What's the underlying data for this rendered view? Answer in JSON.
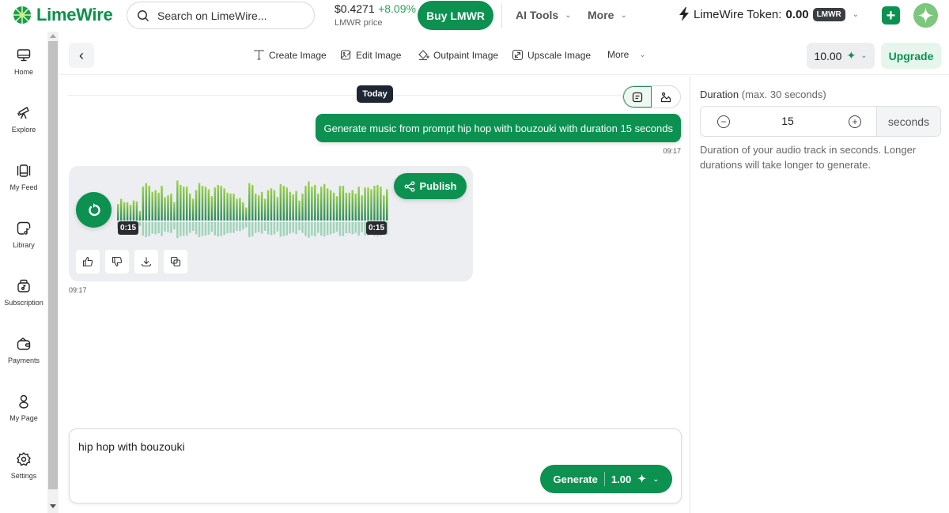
{
  "header": {
    "brand": "LimeWire",
    "search_placeholder": "Search on LimeWire...",
    "price_value": "$0.4271",
    "price_change": "+8.09%",
    "price_label": "LMWR price",
    "buy_label": "Buy LMWR",
    "menus": [
      {
        "label": "AI Tools"
      },
      {
        "label": "More"
      }
    ],
    "token_label": "LimeWire Token:",
    "token_value": "0.00",
    "token_badge": "LMWR"
  },
  "sidebar": {
    "items": [
      {
        "label": "Home",
        "icon": "monitor-icon"
      },
      {
        "label": "Explore",
        "icon": "telescope-icon"
      },
      {
        "label": "My Feed",
        "icon": "feed-icon"
      },
      {
        "label": "Library",
        "icon": "library-icon"
      },
      {
        "label": "Subscription",
        "icon": "subscription-icon"
      },
      {
        "label": "Payments",
        "icon": "wallet-icon"
      },
      {
        "label": "My Page",
        "icon": "user-icon"
      },
      {
        "label": "Settings",
        "icon": "gear-icon"
      }
    ]
  },
  "toolbar": {
    "tools": [
      {
        "label": "Create Image",
        "icon": "text-icon"
      },
      {
        "label": "Edit Image",
        "icon": "edit-image-icon"
      },
      {
        "label": "Outpaint Image",
        "icon": "outpaint-icon"
      },
      {
        "label": "Upscale Image",
        "icon": "upscale-icon"
      },
      {
        "label": "More",
        "icon": "chevron-down-icon"
      }
    ],
    "credits": "10.00",
    "upgrade_label": "Upgrade"
  },
  "chat": {
    "date_divider": "Today",
    "user_message": "Generate music from prompt hip hop with bouzouki with duration 15 seconds",
    "user_message_time": "09:17",
    "audio": {
      "start_time": "0:15",
      "end_time": "0:15",
      "publish_label": "Publish",
      "waveform": [
        0.38,
        0.5,
        0.42,
        0.42,
        0.36,
        0.46,
        0.44,
        0.22,
        0.78,
        0.86,
        0.8,
        0.66,
        0.7,
        0.64,
        0.8,
        0.54,
        0.58,
        0.62,
        0.42,
        0.92,
        0.82,
        0.78,
        0.78,
        0.62,
        0.5,
        0.7,
        0.86,
        0.8,
        0.78,
        0.72,
        0.56,
        0.76,
        0.82,
        0.8,
        0.74,
        0.64,
        0.62,
        0.62,
        0.5,
        0.52,
        0.42,
        0.3,
        0.86,
        0.82,
        0.62,
        0.58,
        0.66,
        0.5,
        0.7,
        0.74,
        0.7,
        0.54,
        0.84,
        0.8,
        0.76,
        0.66,
        0.6,
        0.68,
        0.46,
        0.62,
        0.8,
        0.9,
        0.78,
        0.82,
        0.62,
        0.78,
        0.84,
        0.74,
        0.7,
        0.64,
        0.56,
        0.8,
        0.8,
        0.64,
        0.64,
        0.7,
        0.62,
        0.78,
        0.58,
        0.76,
        0.76,
        0.72,
        0.8,
        0.82,
        0.78,
        0.58,
        0.72
      ],
      "message_time": "09:17",
      "actions": [
        {
          "name": "like-button",
          "icon": "thumbs-up-icon"
        },
        {
          "name": "dislike-button",
          "icon": "thumbs-down-icon"
        },
        {
          "name": "download-button",
          "icon": "download-icon"
        },
        {
          "name": "copy-button",
          "icon": "copy-icon"
        }
      ]
    },
    "prompt_value": "hip hop with bouzouki",
    "generate_label": "Generate",
    "generate_cost": "1.00"
  },
  "settings_panel": {
    "duration_label": "Duration",
    "duration_hint": "(max. 30 seconds)",
    "duration_value": "15",
    "duration_unit": "seconds",
    "duration_help": "Duration of your audio track in seconds. Longer durations will take longer to generate."
  },
  "colors": {
    "brand_green": "#0c9150",
    "wave_top": "#8bc34a",
    "wave_bottom": "#2e8b57",
    "wave_reflection": "#9fd3b8"
  }
}
